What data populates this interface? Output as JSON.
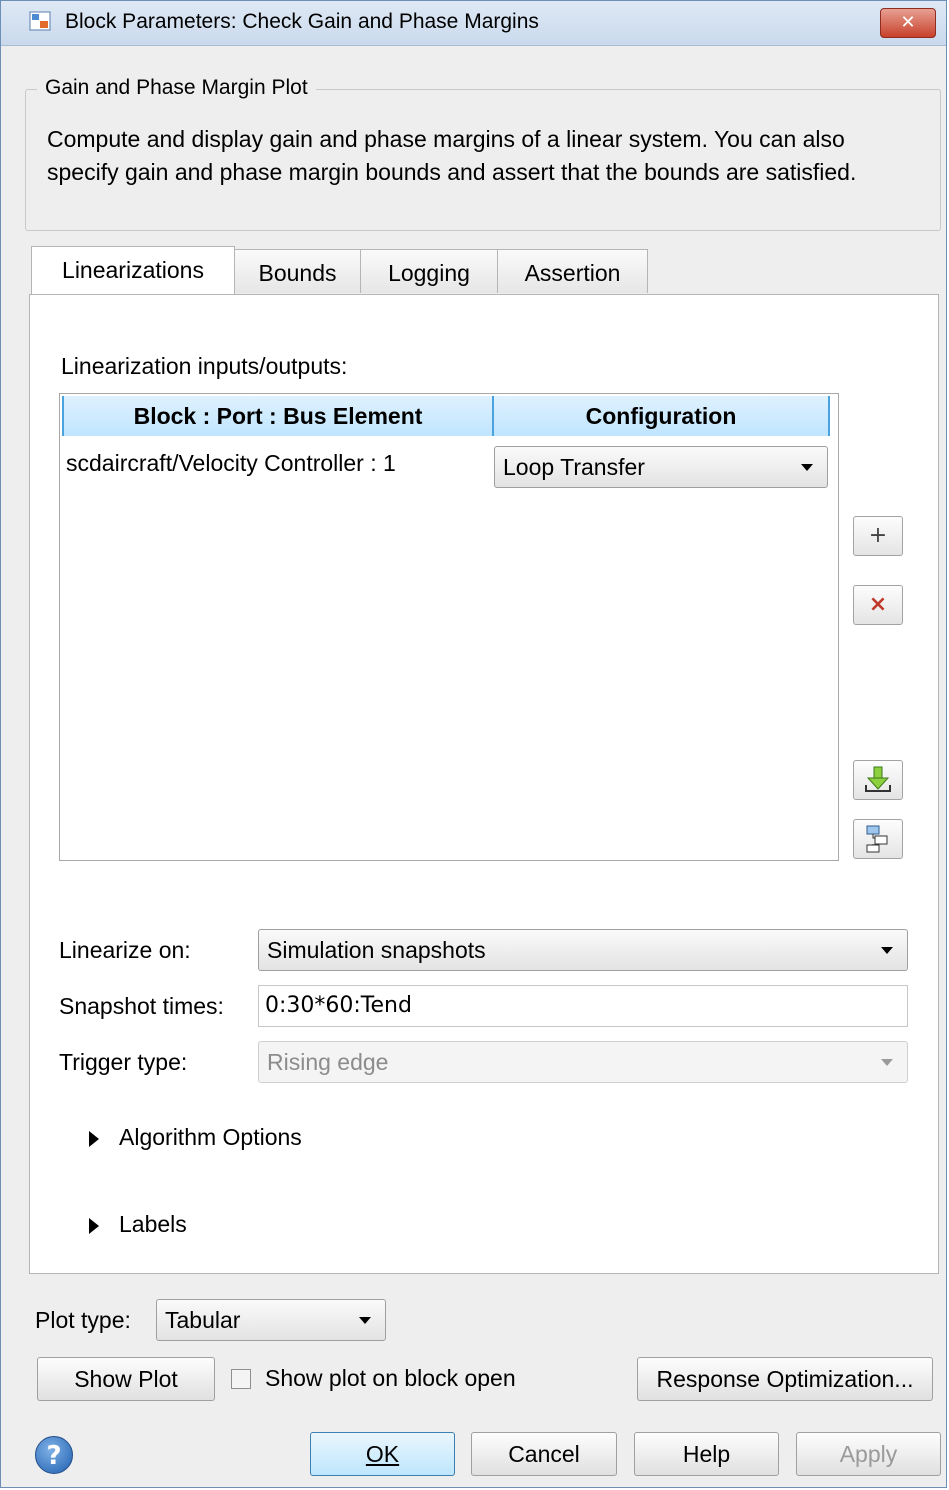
{
  "window": {
    "title": "Block Parameters: Check Gain and Phase Margins",
    "close_label": "✕"
  },
  "group": {
    "legend": "Gain and Phase Margin Plot",
    "description": "Compute and display gain and phase margins of a linear system. You can also specify gain and phase margin bounds and assert that the bounds are satisfied."
  },
  "tabs": [
    {
      "label": "Linearizations"
    },
    {
      "label": "Bounds"
    },
    {
      "label": "Logging"
    },
    {
      "label": "Assertion"
    }
  ],
  "linearizations": {
    "io_label": "Linearization inputs/outputs:",
    "table": {
      "headers": [
        "Block : Port : Bus Element",
        "Configuration"
      ],
      "rows": [
        {
          "block": "scdaircraft/Velocity Controller : 1",
          "configuration": "Loop Transfer"
        }
      ]
    },
    "add_label": "+",
    "delete_label": "×",
    "linearize_on_label": "Linearize on:",
    "linearize_on_value": "Simulation snapshots",
    "snapshot_times_label": "Snapshot times:",
    "snapshot_times_value": "0:30*60:Tend",
    "trigger_type_label": "Trigger type:",
    "trigger_type_value": "Rising edge",
    "algorithm_options_label": "Algorithm Options",
    "labels_label": "Labels"
  },
  "plot": {
    "plot_type_label": "Plot type:",
    "plot_type_value": "Tabular",
    "show_plot_label": "Show Plot",
    "show_on_open_label": "Show plot on block open",
    "show_on_open_checked": false,
    "response_optimization_label": "Response Optimization..."
  },
  "footer": {
    "help_icon_glyph": "?",
    "ok_label": "OK",
    "cancel_label": "Cancel",
    "help_label": "Help",
    "apply_label": "Apply"
  },
  "colors": {
    "header_blue": "#bfe5ff",
    "delete_red": "#c0392b",
    "default_button": "#bee6fd"
  }
}
